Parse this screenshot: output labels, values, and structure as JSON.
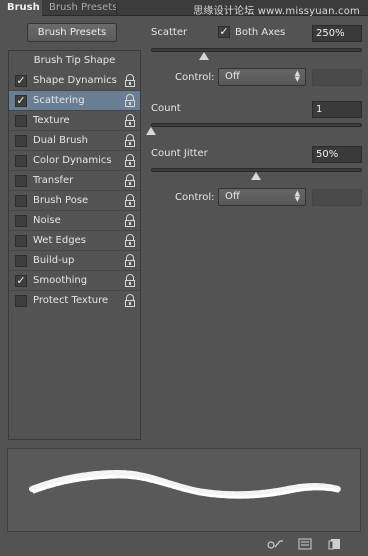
{
  "tabs": {
    "active": "Brush",
    "inactive": "Brush Presets"
  },
  "watermark": "思缘设计论坛 www.missyuan.com",
  "left": {
    "presets_button": "Brush Presets",
    "brush_tip": "Brush Tip Shape",
    "options": [
      {
        "label": "Shape Dynamics",
        "checked": true,
        "selected": false
      },
      {
        "label": "Scattering",
        "checked": true,
        "selected": true
      },
      {
        "label": "Texture",
        "checked": false,
        "selected": false
      },
      {
        "label": "Dual Brush",
        "checked": false,
        "selected": false
      },
      {
        "label": "Color Dynamics",
        "checked": false,
        "selected": false
      },
      {
        "label": "Transfer",
        "checked": false,
        "selected": false
      },
      {
        "label": "Brush Pose",
        "checked": false,
        "selected": false
      },
      {
        "label": "Noise",
        "checked": false,
        "selected": false
      },
      {
        "label": "Wet Edges",
        "checked": false,
        "selected": false
      },
      {
        "label": "Build-up",
        "checked": false,
        "selected": false
      },
      {
        "label": "Smoothing",
        "checked": true,
        "selected": false
      },
      {
        "label": "Protect Texture",
        "checked": false,
        "selected": false
      }
    ]
  },
  "right": {
    "scatter": {
      "label": "Scatter",
      "both_axes_label": "Both Axes",
      "both_axes_checked": true,
      "value": "250%"
    },
    "control1": {
      "label": "Control:",
      "value": "Off"
    },
    "count": {
      "label": "Count",
      "value": "1"
    },
    "count_jitter": {
      "label": "Count Jitter",
      "value": "50%"
    },
    "control2": {
      "label": "Control:",
      "value": "Off"
    }
  },
  "colors": {
    "selection": "#6a7e93",
    "panel": "#535353",
    "field": "#3a3a3a"
  },
  "icons": [
    "expand-icon",
    "menu-icon",
    "lock-icon",
    "toggle-preview-icon",
    "grid-icon",
    "new-preset-icon"
  ]
}
